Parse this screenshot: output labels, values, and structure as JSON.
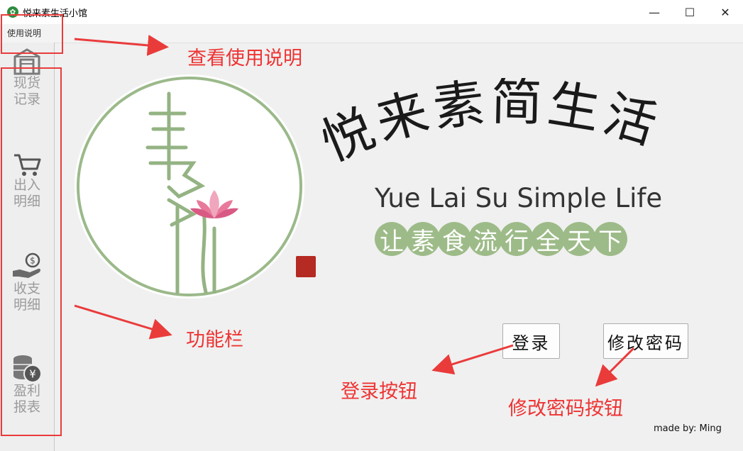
{
  "window": {
    "title": "悦来素生活小馆",
    "app_icon": "leaf-app-icon",
    "controls": {
      "minimize": "—",
      "maximize": "☐",
      "close": "✕"
    }
  },
  "menubar": {
    "help_label": "使用说明"
  },
  "sidebar": {
    "items": [
      {
        "label": "现货记录",
        "icon": "warehouse-icon"
      },
      {
        "label": "出入明细",
        "icon": "cart-icon"
      },
      {
        "label": "收支明细",
        "icon": "hand-coin-icon"
      },
      {
        "label": "盈利报表",
        "icon": "coins-yen-icon"
      }
    ]
  },
  "main": {
    "brand_cn": "悦来素简生活",
    "brand_en": "Yue Lai Su Simple Life",
    "slogan": [
      "让",
      "素",
      "食",
      "流",
      "行",
      "全",
      "天",
      "下"
    ],
    "login_label": "登录",
    "change_pwd_label": "修改密码",
    "credit": "made by: Ming"
  },
  "annotations": {
    "help": "查看使用说明",
    "sidebar": "功能栏",
    "login": "登录按钮",
    "change_pwd": "修改密码按钮"
  },
  "colors": {
    "annotation_red": "#ea3b3b",
    "brand_green": "#9dbb88",
    "sidebar_text": "#9b9b9b"
  }
}
